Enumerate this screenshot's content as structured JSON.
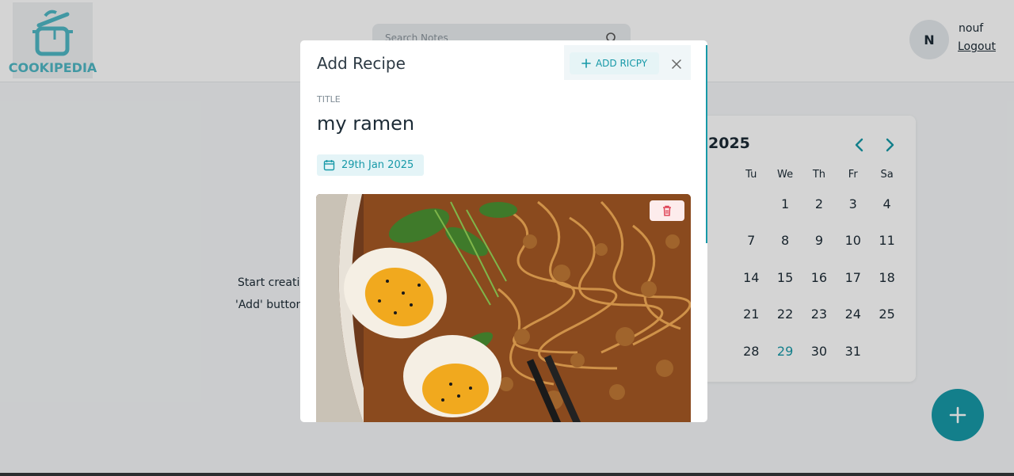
{
  "app": {
    "logo_text": "COOKIPEDIA",
    "brand_color": "#4fb7c5",
    "accent_color": "#1799a8"
  },
  "header": {
    "search_placeholder": "Search Notes",
    "avatar_initial": "N",
    "user_name": "nouf",
    "logout_label": "Logout"
  },
  "main": {
    "empty_line_1": "Start creati",
    "empty_line_2": "'Add' button"
  },
  "calendar": {
    "year_label": "2025",
    "weekdays": [
      "",
      "Tu",
      "We",
      "Th",
      "Fr",
      "Sa"
    ],
    "weeks": [
      [
        "",
        "",
        "1",
        "2",
        "3",
        "4"
      ],
      [
        "",
        "7",
        "8",
        "9",
        "10",
        "11"
      ],
      [
        "",
        "14",
        "15",
        "16",
        "17",
        "18"
      ],
      [
        "",
        "21",
        "22",
        "23",
        "24",
        "25"
      ],
      [
        "",
        "28",
        "29",
        "30",
        "31",
        ""
      ]
    ],
    "selected_day": "29"
  },
  "modal": {
    "title": "Add Recipe",
    "add_button_label": "ADD RICPY",
    "field_label": "TITLE",
    "title_value": "my ramen",
    "date_label": "29th Jan 2025"
  },
  "icons": {
    "search": "search-icon",
    "close": "close-icon",
    "plus": "plus-icon",
    "calendar": "calendar-icon",
    "trash": "trash-icon",
    "prev": "chevron-left-icon",
    "next": "chevron-right-icon"
  }
}
